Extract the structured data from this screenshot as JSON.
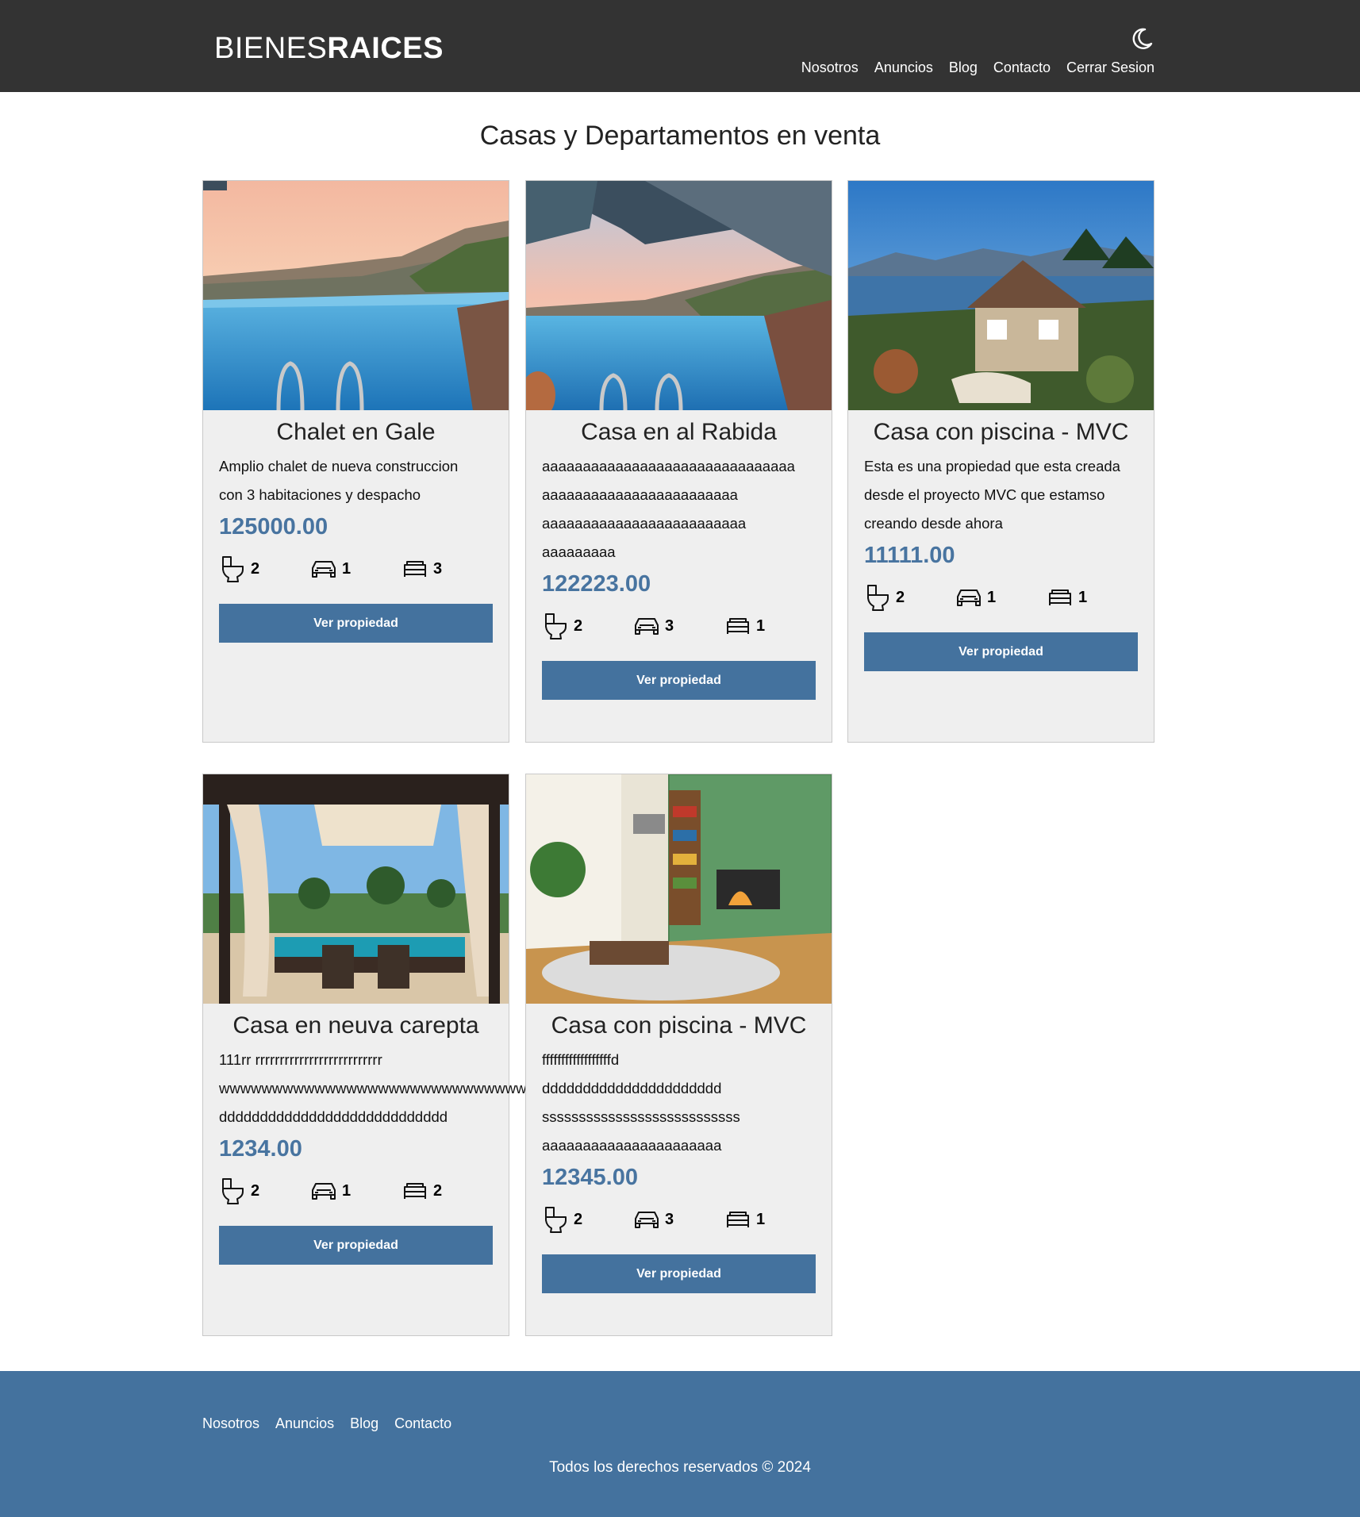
{
  "header": {
    "logo_light": "BIENES",
    "logo_bold": "RAICES",
    "nav": [
      "Nosotros",
      "Anuncios",
      "Blog",
      "Contacto",
      "Cerrar Sesion"
    ],
    "dark_mode_icon": "moon-icon"
  },
  "main": {
    "title": "Casas y Departamentos en venta",
    "button_label": "Ver propiedad",
    "icons": {
      "wc": "toilet-icon",
      "parking": "car-icon",
      "rooms": "bed-icon"
    },
    "cards": [
      {
        "image": "infinity-pool-sunset",
        "title": "Chalet en Gale",
        "description": [
          "Amplio chalet de nueva construccion",
          "con 3 habitaciones y despacho"
        ],
        "price": "125000.00",
        "wc": "2",
        "parking": "1",
        "rooms": "3"
      },
      {
        "image": "terrace-pool-pergola",
        "title": "Casa en al Rabida",
        "description": [
          "aaaaaaaaaaaaaaaaaaaaaaaaaaaaaaa",
          "aaaaaaaaaaaaaaaaaaaaaaaa",
          "aaaaaaaaaaaaaaaaaaaaaaaaa",
          "aaaaaaaaa"
        ],
        "price": "122223.00",
        "wc": "2",
        "parking": "3",
        "rooms": "1"
      },
      {
        "image": "lake-house",
        "title": "Casa con piscina - MVC",
        "description": [
          "Esta es una propiedad que esta creada",
          "desde el proyecto MVC que estamso",
          "creando desde ahora"
        ],
        "price": "11111.00",
        "wc": "2",
        "parking": "1",
        "rooms": "1"
      },
      {
        "image": "gazebo-terrace",
        "title": "Casa en neuva carepta",
        "description": [
          "111rr rrrrrrrrrrrrrrrrrrrrrrrrrr",
          "wwwwwwwwwwwwwwwwwwwwwwwwwwwwww",
          "dddddddddddddddddddddddddddd"
        ],
        "price": "1234.00",
        "wc": "2",
        "parking": "1",
        "rooms": "2"
      },
      {
        "image": "living-room-fireplace",
        "title": "Casa con piscina - MVC",
        "description": [
          "ffffffffffffffffffd",
          "dddddddddddddddddddddd",
          "sssssssssssssssssssssssssss",
          "aaaaaaaaaaaaaaaaaaaaaa"
        ],
        "price": "12345.00",
        "wc": "2",
        "parking": "3",
        "rooms": "1"
      }
    ]
  },
  "footer": {
    "nav": [
      "Nosotros",
      "Anuncios",
      "Blog",
      "Contacto"
    ],
    "copyright": "Todos los derechos reservados © 2024"
  },
  "colors": {
    "header_bg": "#333333",
    "accent": "#44729e",
    "card_bg": "#efefef",
    "price": "#4874a0"
  }
}
